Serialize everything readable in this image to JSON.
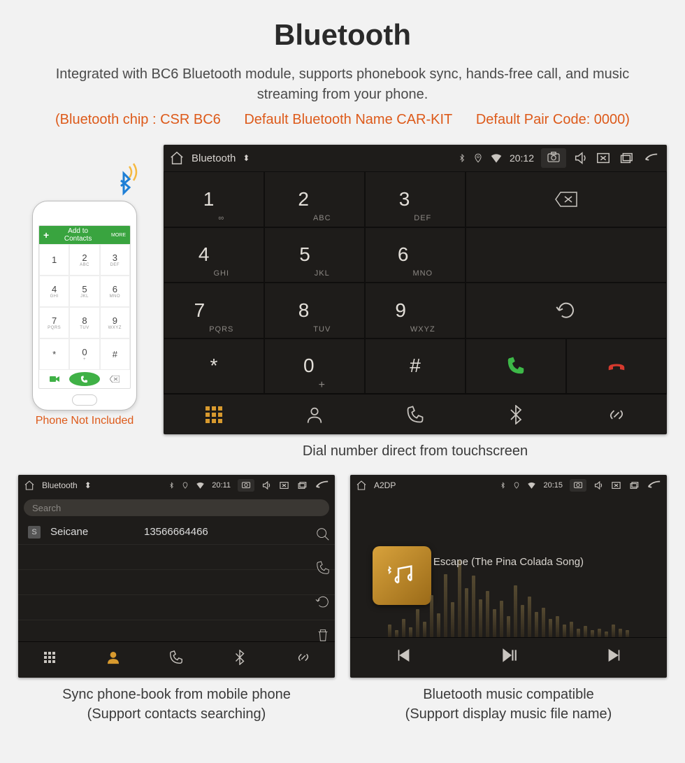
{
  "header": {
    "title": "Bluetooth",
    "subtitle": "Integrated with BC6 Bluetooth module, supports phonebook sync, hands-free call, and music streaming from your phone.",
    "spec_chip": "(Bluetooth chip : CSR BC6",
    "spec_name": "Default Bluetooth Name CAR-KIT",
    "spec_code": "Default Pair Code: 0000)"
  },
  "phone": {
    "caption": "Phone Not Included",
    "topbar_label": "Add to Contacts",
    "more": "MORE",
    "keys": [
      {
        "n": "1",
        "s": ""
      },
      {
        "n": "2",
        "s": "ABC"
      },
      {
        "n": "3",
        "s": "DEF"
      },
      {
        "n": "4",
        "s": "GHI"
      },
      {
        "n": "5",
        "s": "JKL"
      },
      {
        "n": "6",
        "s": "MNO"
      },
      {
        "n": "7",
        "s": "PQRS"
      },
      {
        "n": "8",
        "s": "TUV"
      },
      {
        "n": "9",
        "s": "WXYZ"
      },
      {
        "n": "*",
        "s": ""
      },
      {
        "n": "0",
        "s": "+"
      },
      {
        "n": "#",
        "s": ""
      }
    ]
  },
  "dialer": {
    "status_title": "Bluetooth",
    "time": "20:12",
    "keys": [
      {
        "n": "1",
        "s": "∞"
      },
      {
        "n": "2",
        "s": "ABC"
      },
      {
        "n": "3",
        "s": "DEF"
      },
      {
        "n": "4",
        "s": "GHI"
      },
      {
        "n": "5",
        "s": "JKL"
      },
      {
        "n": "6",
        "s": "MNO"
      },
      {
        "n": "7",
        "s": "PQRS"
      },
      {
        "n": "8",
        "s": "TUV"
      },
      {
        "n": "9",
        "s": "WXYZ"
      },
      {
        "n": "*",
        "s": ""
      },
      {
        "n": "0",
        "s": "+"
      },
      {
        "n": "#",
        "s": ""
      }
    ],
    "caption": "Dial number direct from touchscreen"
  },
  "phonebook": {
    "status_title": "Bluetooth",
    "time": "20:11",
    "search_placeholder": "Search",
    "contact_badge": "S",
    "contact_name": "Seicane",
    "contact_number": "13566664466",
    "caption_l1": "Sync phone-book from mobile phone",
    "caption_l2": "(Support contacts searching)"
  },
  "music": {
    "status_title": "A2DP",
    "time": "20:15",
    "song": "Escape (The Pina Colada Song)",
    "caption_l1": "Bluetooth music compatible",
    "caption_l2": "(Support display music file name)"
  }
}
